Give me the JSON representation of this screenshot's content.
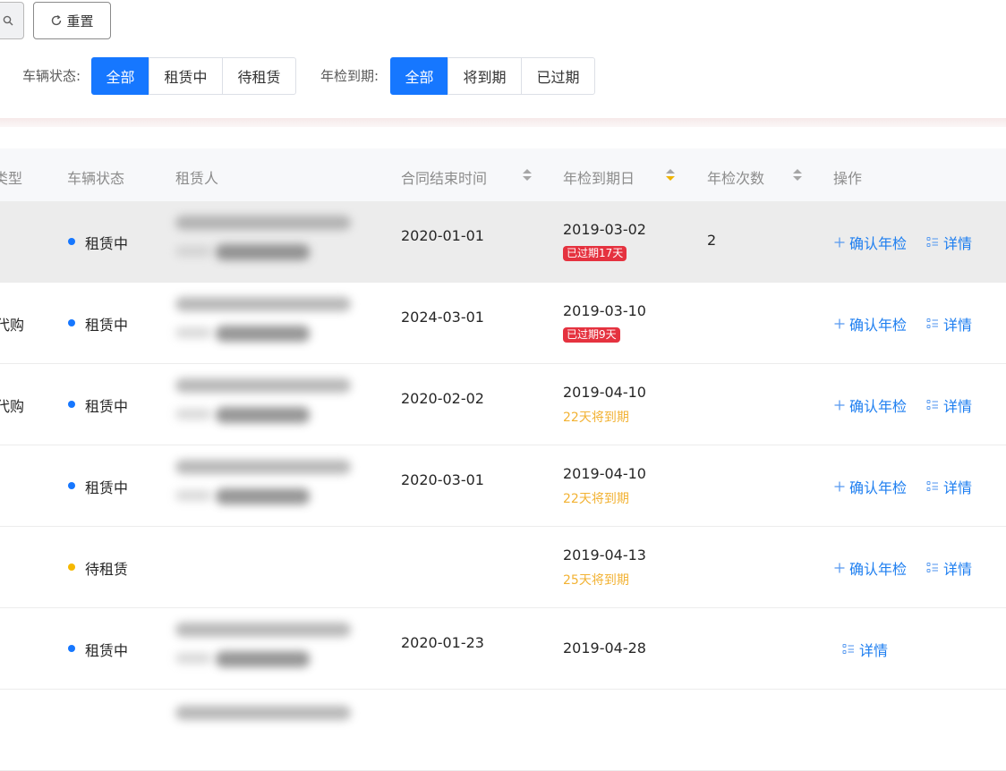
{
  "toolbar": {
    "reset_label": "重置"
  },
  "filters": {
    "vehicle_status": {
      "label": "车辆状态:",
      "options": [
        "全部",
        "租赁中",
        "待租赁"
      ],
      "selected": "全部"
    },
    "inspection_due": {
      "label": "年检到期:",
      "options": [
        "全部",
        "将到期",
        "已过期"
      ],
      "selected": "全部"
    }
  },
  "table": {
    "columns": {
      "type": "类型",
      "status": "车辆状态",
      "renter": "租赁人",
      "end_time": "合同结束时间",
      "inspection_date": "年检到期日",
      "inspection_count": "年检次数",
      "actions": "操作"
    },
    "rows": [
      {
        "type": "",
        "status": "租赁中",
        "end_time": "2020-01-01",
        "inspection_date": "2019-03-02",
        "badge": "已过期17天",
        "soon": "",
        "count": "2",
        "confirm": "确认年检",
        "detail": "详情"
      },
      {
        "type": "代购",
        "status": "租赁中",
        "end_time": "2024-03-01",
        "inspection_date": "2019-03-10",
        "badge": "已过期9天",
        "soon": "",
        "count": "",
        "confirm": "确认年检",
        "detail": "详情"
      },
      {
        "type": "代购",
        "status": "租赁中",
        "end_time": "2020-02-02",
        "inspection_date": "2019-04-10",
        "badge": "",
        "soon": "22天将到期",
        "count": "",
        "confirm": "确认年检",
        "detail": "详情"
      },
      {
        "type": "",
        "status": "租赁中",
        "end_time": "2020-03-01",
        "inspection_date": "2019-04-10",
        "badge": "",
        "soon": "22天将到期",
        "count": "",
        "confirm": "确认年检",
        "detail": "详情"
      },
      {
        "type": "",
        "status": "待租赁",
        "end_time": "",
        "inspection_date": "2019-04-13",
        "badge": "",
        "soon": "25天将到期",
        "count": "",
        "confirm": "确认年检",
        "detail": "详情"
      },
      {
        "type": "",
        "status": "租赁中",
        "end_time": "2020-01-23",
        "inspection_date": "2019-04-28",
        "badge": "",
        "soon": "",
        "count": "",
        "confirm": "",
        "detail": "详情"
      }
    ]
  },
  "colors": {
    "primary": "#1677ff",
    "link": "#1d7ef0",
    "status_renting": "#1677ff",
    "status_idle": "#f5b800",
    "overdue": "#e5323f",
    "due_soon": "#f2b233"
  },
  "icons": {
    "search": "search-icon",
    "reset": "refresh-icon",
    "confirm": "plus-icon",
    "detail": "list-icon",
    "sort": "sort-icon"
  }
}
